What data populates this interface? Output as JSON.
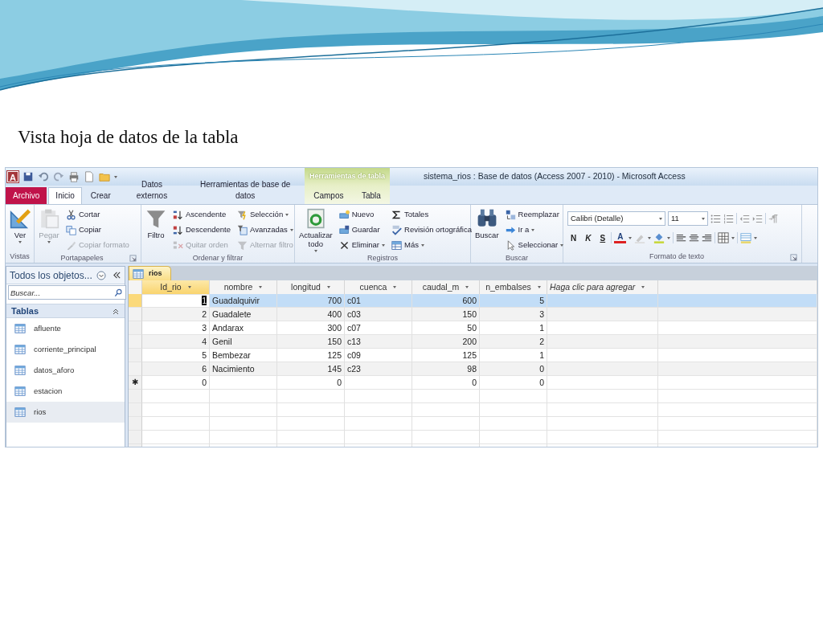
{
  "slide": {
    "title": "Vista hoja de datos de la tabla"
  },
  "window": {
    "app_icon": "A",
    "title": "sistema_rios : Base de datos (Access 2007 - 2010) - Microsoft Access",
    "context_group": "Herramientas de tabla"
  },
  "tabs": [
    {
      "label": "Archivo",
      "kind": "file",
      "selected": false
    },
    {
      "label": "Inicio",
      "kind": "main",
      "selected": true
    },
    {
      "label": "Crear",
      "kind": "main",
      "selected": false
    },
    {
      "label": "Datos externos",
      "kind": "main",
      "selected": false
    },
    {
      "label": "Herramientas de base de datos",
      "kind": "main",
      "selected": false
    },
    {
      "label": "Campos",
      "kind": "context",
      "selected": false
    },
    {
      "label": "Tabla",
      "kind": "context",
      "selected": false
    }
  ],
  "ribbon_groups": [
    {
      "name": "Vistas",
      "kind": "buttons",
      "launcher": false,
      "items": [
        {
          "label": "Ver",
          "kind": "large",
          "dropdown": true,
          "disabled": false
        }
      ]
    },
    {
      "name": "Portapapeles",
      "kind": "buttons",
      "launcher": true,
      "items": [
        {
          "label": "Pegar",
          "kind": "large",
          "dropdown": true,
          "disabled": true
        },
        {
          "label": "Cortar",
          "kind": "small",
          "dropdown": false,
          "disabled": false
        },
        {
          "label": "Copiar",
          "kind": "small",
          "dropdown": false,
          "disabled": false
        },
        {
          "label": "Copiar formato",
          "kind": "small",
          "dropdown": false,
          "disabled": true
        }
      ]
    },
    {
      "name": "Ordenar y filtrar",
      "kind": "buttons",
      "launcher": false,
      "items": [
        {
          "label": "Filtro",
          "kind": "large",
          "dropdown": false,
          "disabled": false
        },
        {
          "label": "Ascendente",
          "kind": "small",
          "dropdown": false,
          "disabled": false
        },
        {
          "label": "Descendente",
          "kind": "small",
          "dropdown": false,
          "disabled": false
        },
        {
          "label": "Quitar orden",
          "kind": "small",
          "dropdown": false,
          "disabled": true
        },
        {
          "label": "Selección",
          "kind": "small",
          "dropdown": true,
          "disabled": false
        },
        {
          "label": "Avanzadas",
          "kind": "small",
          "dropdown": true,
          "disabled": false
        },
        {
          "label": "Alternar filtro",
          "kind": "small",
          "dropdown": false,
          "disabled": true
        }
      ]
    },
    {
      "name": "Registros",
      "kind": "buttons",
      "launcher": false,
      "items": [
        {
          "label": "Actualizar todo",
          "kind": "large",
          "dropdown": true,
          "disabled": false
        },
        {
          "label": "Nuevo",
          "kind": "small",
          "dropdown": false,
          "disabled": false
        },
        {
          "label": "Guardar",
          "kind": "small",
          "dropdown": false,
          "disabled": false
        },
        {
          "label": "Eliminar",
          "kind": "small",
          "dropdown": true,
          "disabled": false
        },
        {
          "label": "Totales",
          "kind": "small",
          "dropdown": false,
          "disabled": false
        },
        {
          "label": "Revisión ortográfica",
          "kind": "small",
          "dropdown": false,
          "disabled": false
        },
        {
          "label": "Más",
          "kind": "small",
          "dropdown": true,
          "disabled": false
        }
      ]
    },
    {
      "name": "Buscar",
      "kind": "buttons",
      "launcher": false,
      "items": [
        {
          "label": "Buscar",
          "kind": "large",
          "dropdown": false,
          "disabled": false
        },
        {
          "label": "Reemplazar",
          "kind": "small",
          "dropdown": false,
          "disabled": false
        },
        {
          "label": "Ir a",
          "kind": "small",
          "dropdown": true,
          "disabled": false
        },
        {
          "label": "Seleccionar",
          "kind": "small",
          "dropdown": true,
          "disabled": false
        }
      ]
    },
    {
      "name": "Formato de texto",
      "kind": "format",
      "launcher": true
    }
  ],
  "text_format": {
    "font": "Calibri (Detalle)",
    "size": "11",
    "style_buttons": [
      "N",
      "K",
      "S"
    ],
    "font_color_letter": "A"
  },
  "nav_pane": {
    "header": "Todos los objetos...",
    "search_placeholder": "Buscar...",
    "section": "Tablas",
    "items": [
      {
        "label": "afluente",
        "selected": false
      },
      {
        "label": "corriente_principal",
        "selected": false
      },
      {
        "label": "datos_aforo",
        "selected": false
      },
      {
        "label": "estacion",
        "selected": false
      },
      {
        "label": "rios",
        "selected": true
      }
    ]
  },
  "document_tab": "rios",
  "table": {
    "columns": [
      {
        "label": "Id_rio",
        "kind": "number",
        "selected": true
      },
      {
        "label": "nombre",
        "kind": "text",
        "selected": false
      },
      {
        "label": "longitud",
        "kind": "number",
        "selected": false
      },
      {
        "label": "cuenca",
        "kind": "text",
        "selected": false
      },
      {
        "label": "caudal_m",
        "kind": "number",
        "selected": false
      },
      {
        "label": "n_embalses",
        "kind": "number",
        "selected": false
      },
      {
        "label": "Haga clic para agregar",
        "kind": "add",
        "selected": false
      }
    ],
    "rows": [
      {
        "cells": [
          "1",
          "Guadalquivir",
          "700",
          "c01",
          "600",
          "5"
        ],
        "selected": true
      },
      {
        "cells": [
          "2",
          "Guadalete",
          "400",
          "c03",
          "150",
          "3"
        ],
        "selected": false
      },
      {
        "cells": [
          "3",
          "Andarax",
          "300",
          "c07",
          "50",
          "1"
        ],
        "selected": false
      },
      {
        "cells": [
          "4",
          "Genil",
          "150",
          "c13",
          "200",
          "2"
        ],
        "selected": false
      },
      {
        "cells": [
          "5",
          "Bembezar",
          "125",
          "c09",
          "125",
          "1"
        ],
        "selected": false
      },
      {
        "cells": [
          "6",
          "Nacimiento",
          "145",
          "c23",
          "98",
          "0"
        ],
        "selected": false
      }
    ],
    "new_row": {
      "marker": "✱",
      "cells": [
        "0",
        null,
        "0",
        null,
        "0",
        "0"
      ]
    }
  }
}
